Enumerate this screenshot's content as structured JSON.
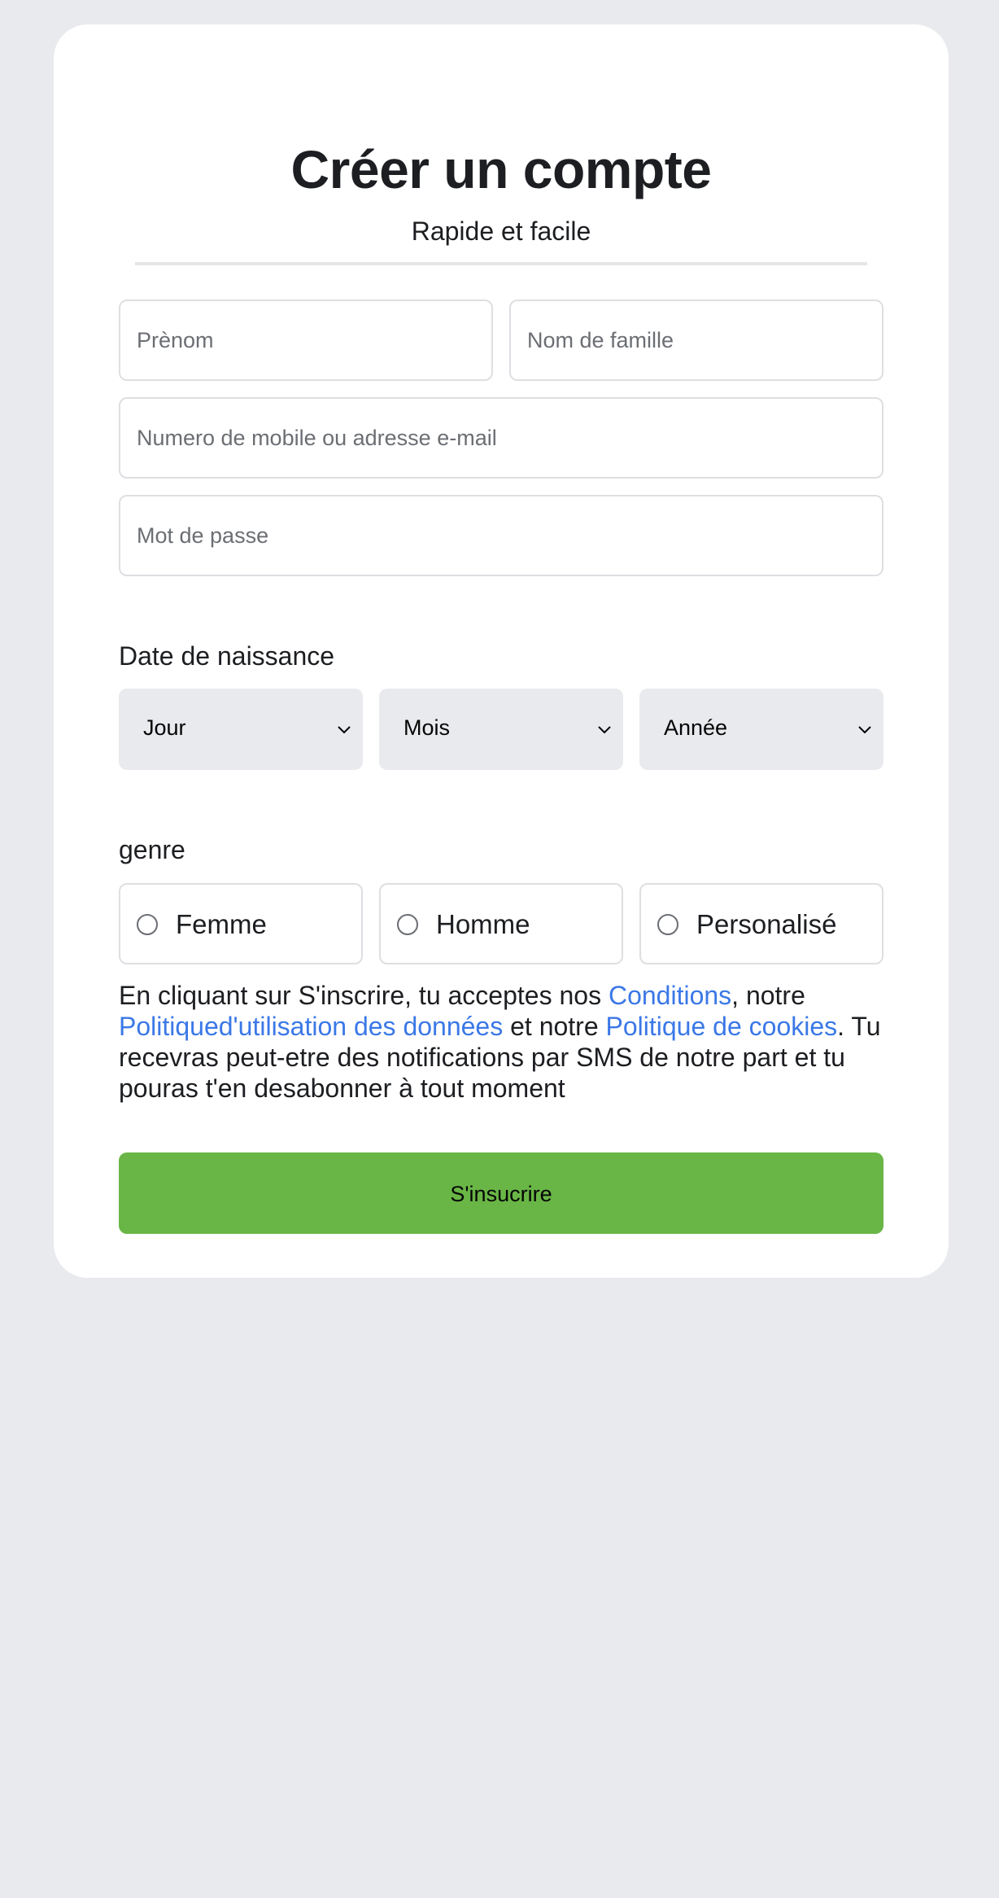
{
  "header": {
    "title": "Créer un compte",
    "subtitle": "Rapide et facile"
  },
  "fields": {
    "first_name_placeholder": "Prènom",
    "last_name_placeholder": "Nom de famille",
    "contact_placeholder": "Numero de mobile ou adresse e-mail",
    "password_placeholder": "Mot de passe",
    "first_name_value": "",
    "last_name_value": "",
    "contact_value": "",
    "password_value": ""
  },
  "birthdate": {
    "label": "Date de naissance",
    "day": "Jour",
    "month": "Mois",
    "year": "Année"
  },
  "gender": {
    "label": "genre",
    "options": [
      "Femme",
      "Homme",
      "Personalisé"
    ]
  },
  "terms": {
    "part1": "En cliquant sur S'inscrire, tu acceptes nos ",
    "link_conditions": "Conditions",
    "part2": ", notre ",
    "link_data_policy": "Politiqued'utilisation des données",
    "part3": " et notre ",
    "link_cookies": "Politique de cookies",
    "part4": ". Tu recevras peut-etre des notifications par SMS de notre part et tu pouras t'en desabonner à tout moment"
  },
  "submit_label": "S'insucrire",
  "colors": {
    "background": "#e9eaed",
    "accent_green": "#69b646",
    "link_blue": "#3b78e7"
  }
}
